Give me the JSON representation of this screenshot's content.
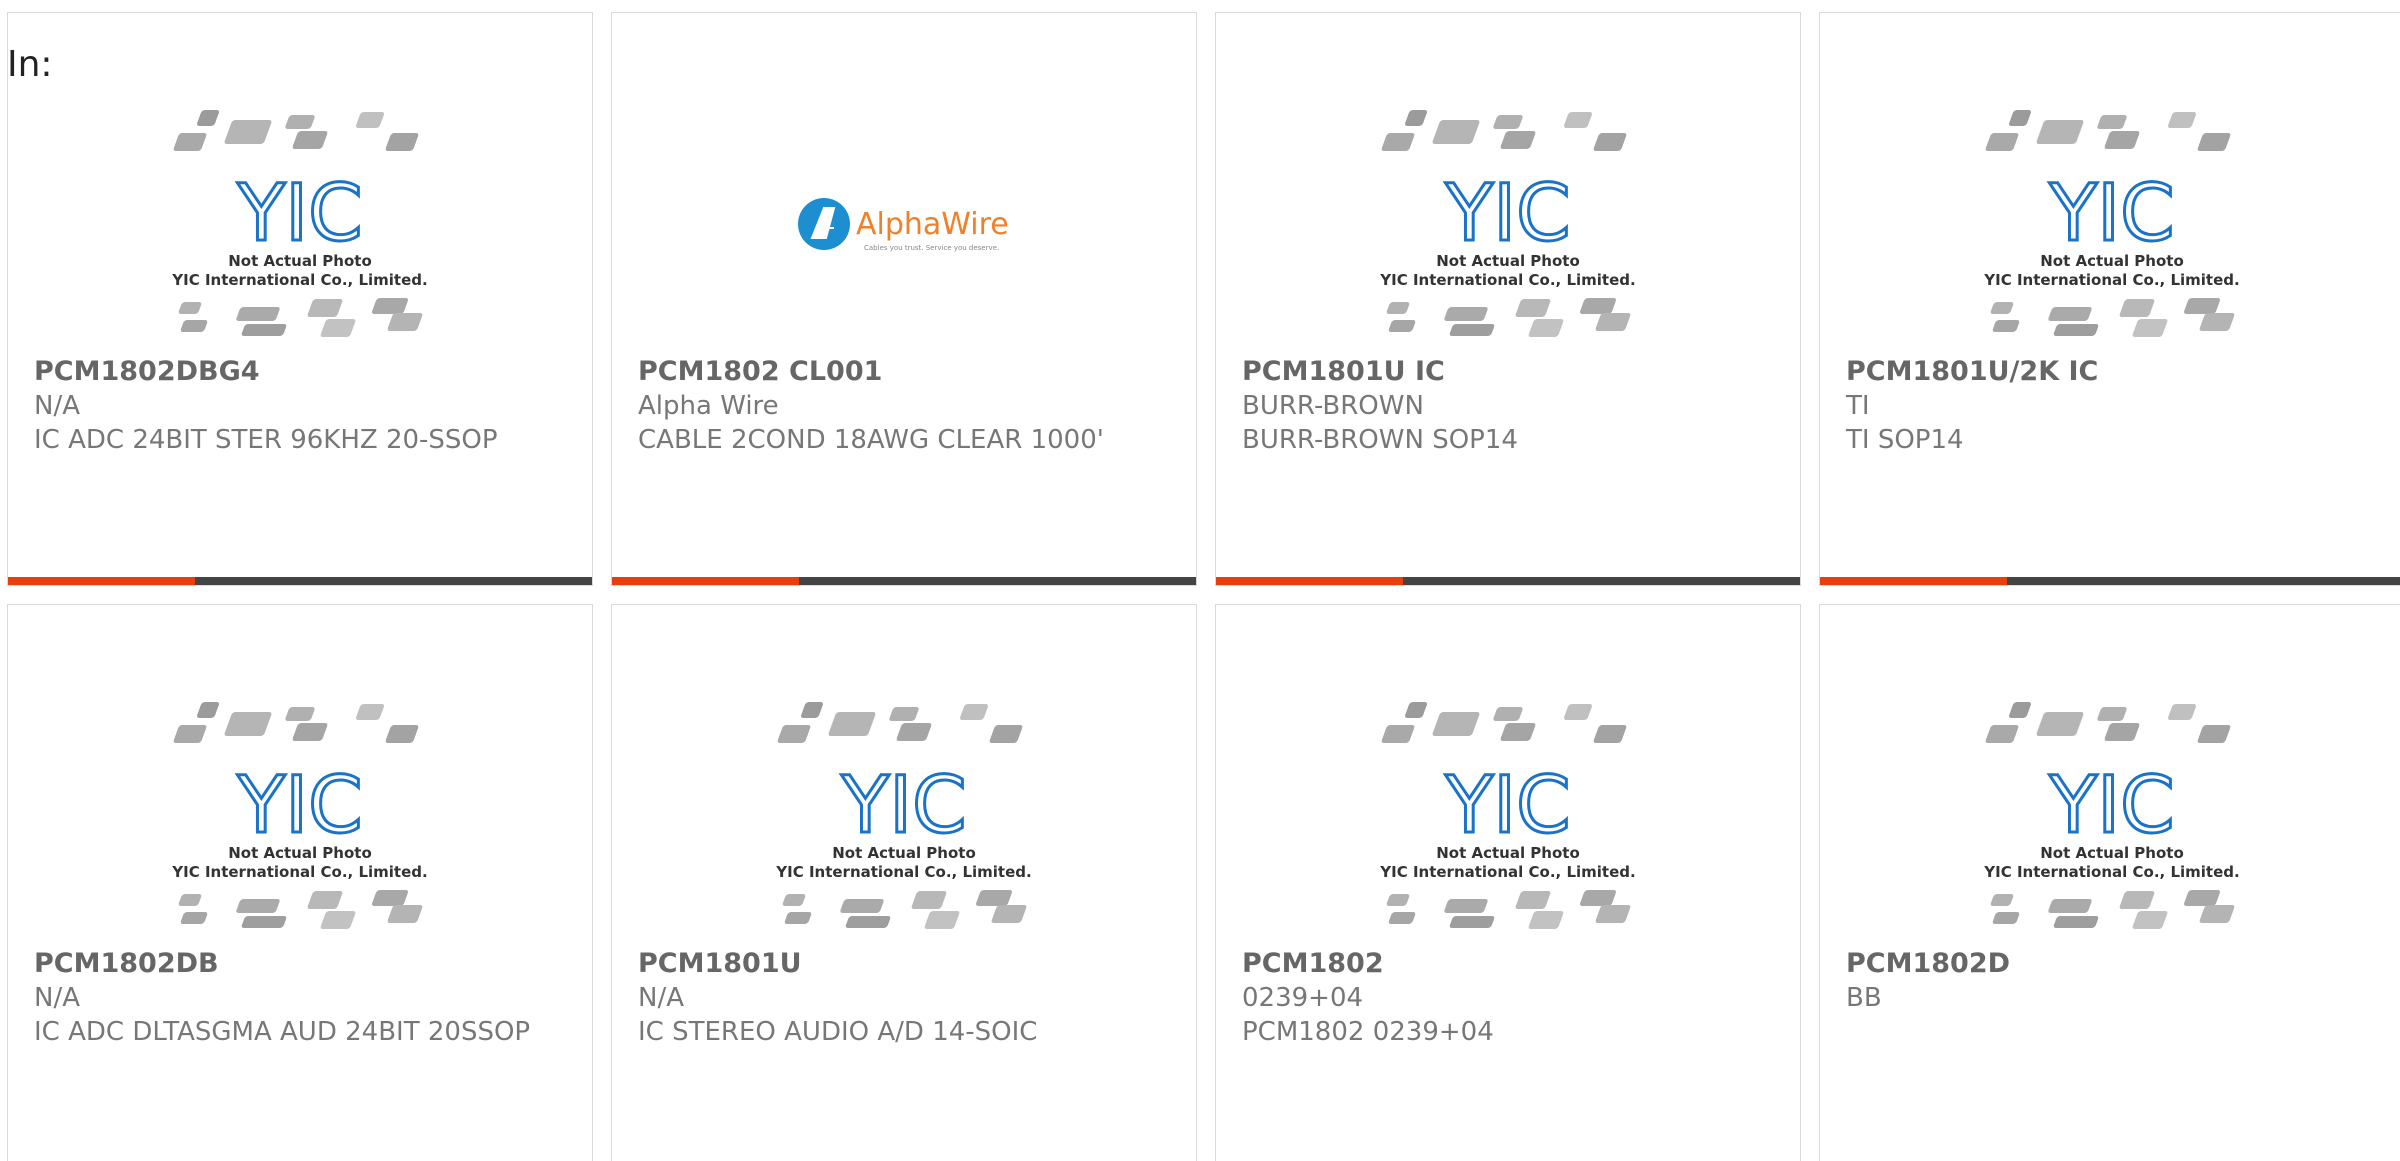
{
  "page": {
    "in_label": "In:"
  },
  "placeholder": {
    "line1": "Not Actual Photo",
    "line2": "YIC International Co., Limited.",
    "logo_text": "YIC"
  },
  "alpha_logo": {
    "name": "AlphaWire",
    "tagline": "Cables you trust. Service you deserve."
  },
  "colors": {
    "accent": "#e8400c",
    "bar_dark": "#444444",
    "yic_blue": "#1a73c8",
    "alpha_orange": "#f0802a"
  },
  "products": [
    {
      "part": "PCM1802DBG4",
      "mfr": "N/A",
      "desc": "IC ADC 24BIT STER 96KHZ 20-SSOP",
      "image": "yic-placeholder",
      "bar_fraction": 0.32
    },
    {
      "part": "PCM1802 CL001",
      "mfr": "Alpha Wire",
      "desc": "CABLE 2COND 18AWG CLEAR 1000'",
      "image": "alphawire-logo",
      "bar_fraction": 0.32
    },
    {
      "part": "PCM1801U IC",
      "mfr": "BURR-BROWN",
      "desc": "BURR-BROWN SOP14",
      "image": "yic-placeholder",
      "bar_fraction": 0.32
    },
    {
      "part": "PCM1801U/2K IC",
      "mfr": "TI",
      "desc": "TI SOP14",
      "image": "yic-placeholder",
      "bar_fraction": 0.32
    },
    {
      "part": "PCM1802DB",
      "mfr": "N/A",
      "desc": "IC ADC DLTASGMA AUD 24BIT 20SSOP",
      "image": "yic-placeholder"
    },
    {
      "part": "PCM1801U",
      "mfr": "N/A",
      "desc": "IC STEREO AUDIO A/D 14-SOIC",
      "image": "yic-placeholder"
    },
    {
      "part": "PCM1802",
      "mfr": "0239+04",
      "desc": "PCM1802 0239+04",
      "image": "yic-placeholder"
    },
    {
      "part": "PCM1802D",
      "mfr": "BB",
      "desc": "",
      "image": "yic-placeholder"
    }
  ]
}
